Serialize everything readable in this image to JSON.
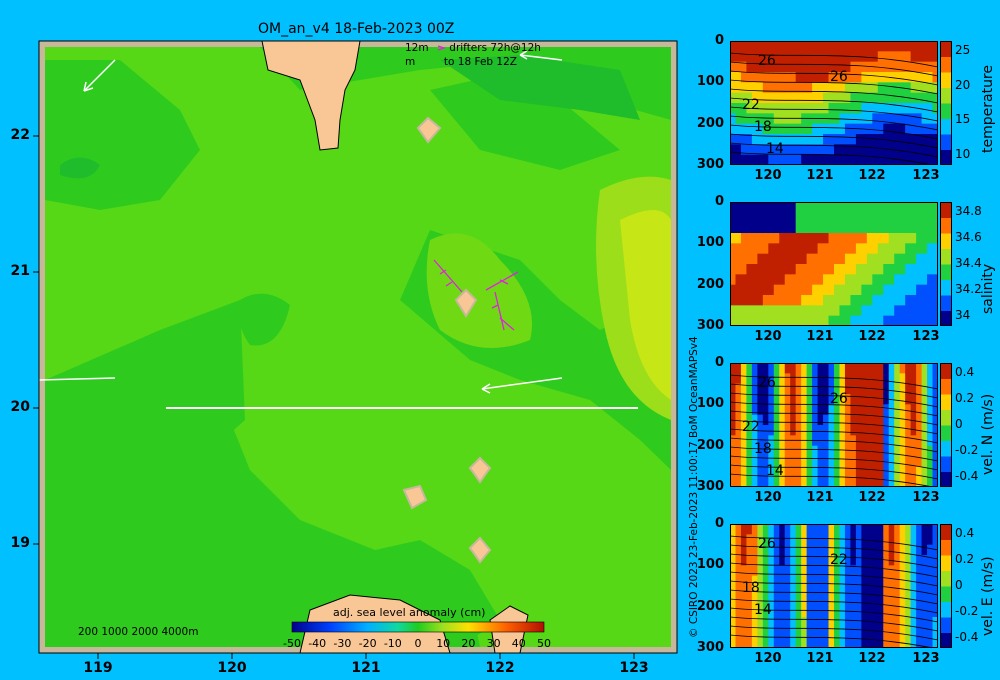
{
  "map": {
    "title": "OM_an_v4  18-Feb-2023 00Z",
    "drifter_legend": {
      "line1": "12m",
      "line2": "m",
      "label1": "drifters 72h@12h",
      "label2": "to 18 Feb 12Z"
    },
    "depth_legend": "200  1000  2000  4000m",
    "colorbar_label": "adj. sea level anomaly (cm)",
    "colorbar_ticks": [
      "-50",
      "-40",
      "-30",
      "-20",
      "-10",
      "0",
      "10",
      "20",
      "30",
      "40",
      "50"
    ],
    "lon_ticks": [
      "119",
      "120",
      "121",
      "122",
      "123"
    ],
    "lat_ticks": [
      "22",
      "21",
      "20",
      "19"
    ],
    "credit": "© CSIRO 2023   23-Feb-2023 11:00:17 BoM OceanMAPSv4"
  },
  "sections": [
    {
      "name": "temperature-section",
      "ylabel": "temperature",
      "cbar_ticks": [
        "25",
        "20",
        "15",
        "10"
      ],
      "contour_labels": [
        "26",
        "26",
        "22",
        "18",
        "14"
      ]
    },
    {
      "name": "salinity-section",
      "ylabel": "salinity",
      "cbar_ticks": [
        "34.8",
        "34.6",
        "34.4",
        "34.2",
        "34"
      ],
      "contour_labels": []
    },
    {
      "name": "velocity-north-section",
      "ylabel": "vel. N (m/s)",
      "cbar_ticks": [
        "0.4",
        "0.2",
        "0",
        "-0.2",
        "-0.4"
      ],
      "contour_labels": [
        "26",
        "26",
        "22",
        "18",
        "14"
      ]
    },
    {
      "name": "velocity-east-section",
      "ylabel": "vel. E (m/s)",
      "cbar_ticks": [
        "0.4",
        "0.2",
        "0",
        "-0.2",
        "-0.4"
      ],
      "contour_labels": [
        "26",
        "22",
        "18",
        "14"
      ]
    }
  ],
  "section_axes": {
    "depth_ticks": [
      "0",
      "100",
      "200",
      "300"
    ],
    "lon_ticks": [
      "120",
      "121",
      "122",
      "123"
    ]
  },
  "chart_data": [
    {
      "type": "heatmap",
      "title": "OM_an_v4  18-Feb-2023 00Z",
      "colorbar": "adj. sea level anomaly (cm)",
      "xlim": [
        118.5,
        123.5
      ],
      "ylim": [
        18.3,
        22.7
      ],
      "clim": [
        -50,
        50
      ],
      "section_line": {
        "lon": [
          119.5,
          123.2
        ],
        "lat": [
          20.0,
          20.0
        ]
      }
    },
    {
      "type": "heatmap",
      "ylabel": "temperature",
      "xlim": [
        119.5,
        123.3
      ],
      "ylim": [
        300,
        0
      ],
      "clim": [
        8,
        28
      ]
    },
    {
      "type": "heatmap",
      "ylabel": "salinity",
      "xlim": [
        119.5,
        123.3
      ],
      "ylim": [
        300,
        0
      ],
      "clim": [
        33.9,
        34.9
      ]
    },
    {
      "type": "heatmap",
      "ylabel": "vel. N (m/s)",
      "xlim": [
        119.5,
        123.3
      ],
      "ylim": [
        300,
        0
      ],
      "clim": [
        -0.5,
        0.5
      ]
    },
    {
      "type": "heatmap",
      "ylabel": "vel. E (m/s)",
      "xlim": [
        119.5,
        123.3
      ],
      "ylim": [
        300,
        0
      ],
      "clim": [
        -0.5,
        0.5
      ]
    }
  ]
}
